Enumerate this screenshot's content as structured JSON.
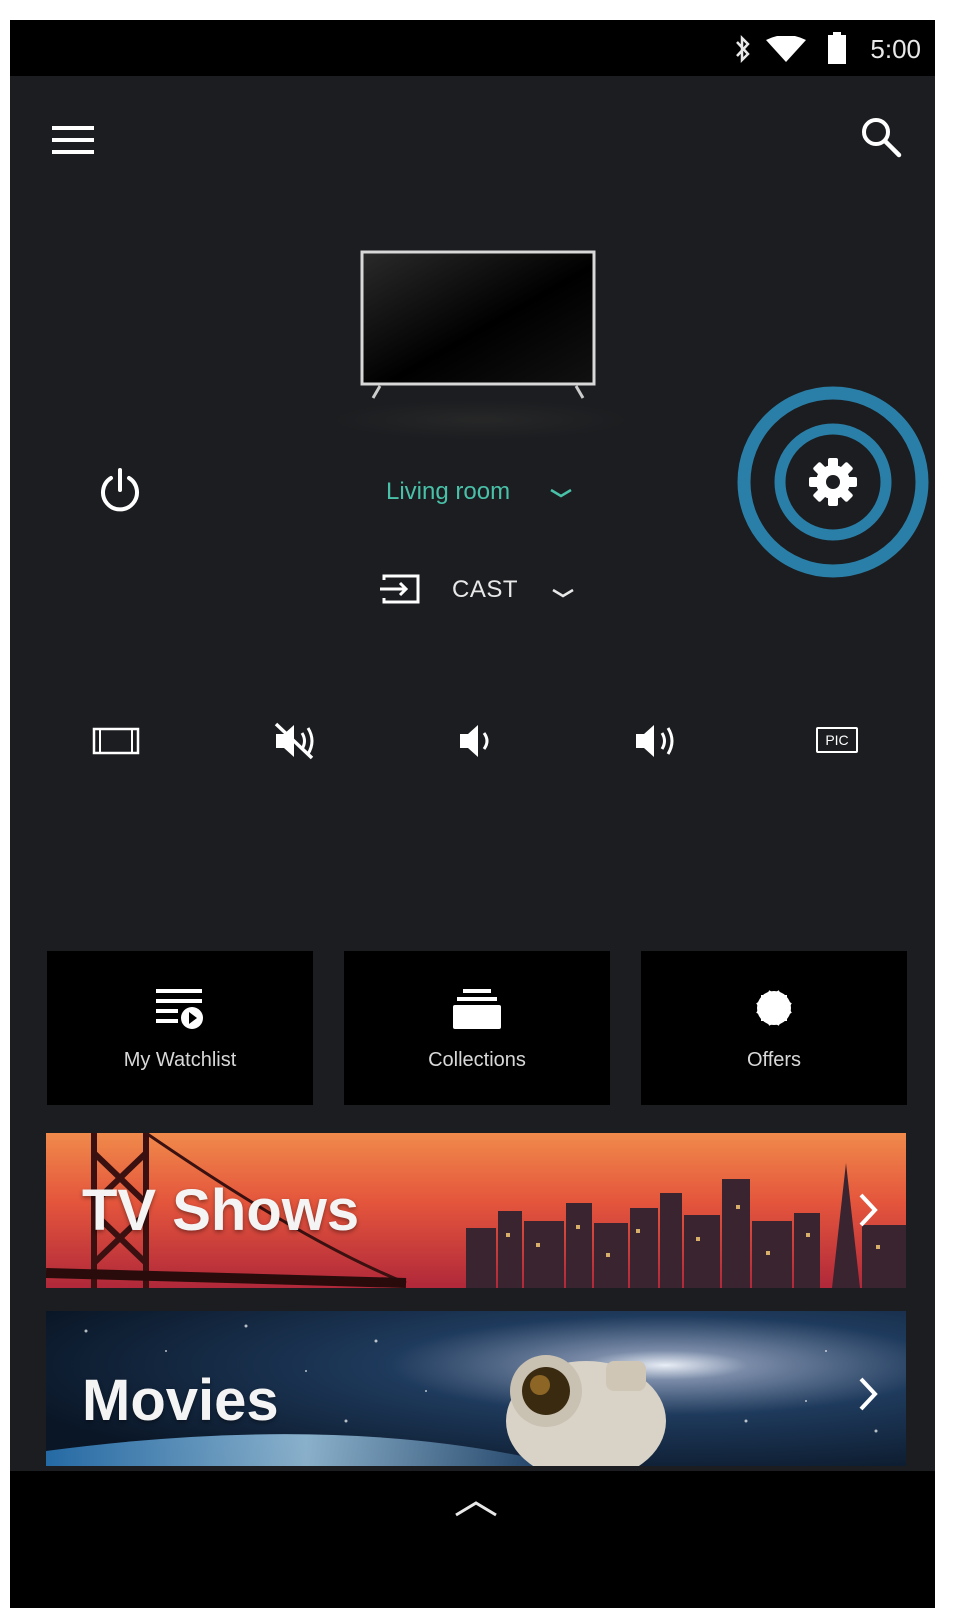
{
  "status_bar": {
    "time": "5:00",
    "icons": [
      "bluetooth-icon",
      "wifi-icon",
      "battery-icon"
    ]
  },
  "app_bar": {
    "menu_icon": "menu-icon",
    "search_icon": "search-icon"
  },
  "device": {
    "room": "Living room",
    "input": "CAST"
  },
  "controls": {
    "icons": [
      "aspect-ratio-icon",
      "mute-icon",
      "volume-down-icon",
      "volume-up-icon",
      "pic-mode-icon"
    ],
    "pic_label": "PIC"
  },
  "tiles": [
    {
      "label": "My Watchlist",
      "icon": "watchlist-icon"
    },
    {
      "label": "Collections",
      "icon": "collections-icon"
    },
    {
      "label": "Offers",
      "icon": "offers-icon"
    }
  ],
  "banners": [
    {
      "title": "TV Shows"
    },
    {
      "title": "Movies"
    }
  ],
  "colors": {
    "background": "#1b1d20",
    "accent_teal": "#49c0a8",
    "highlight_blue": "#2a7fa8"
  }
}
